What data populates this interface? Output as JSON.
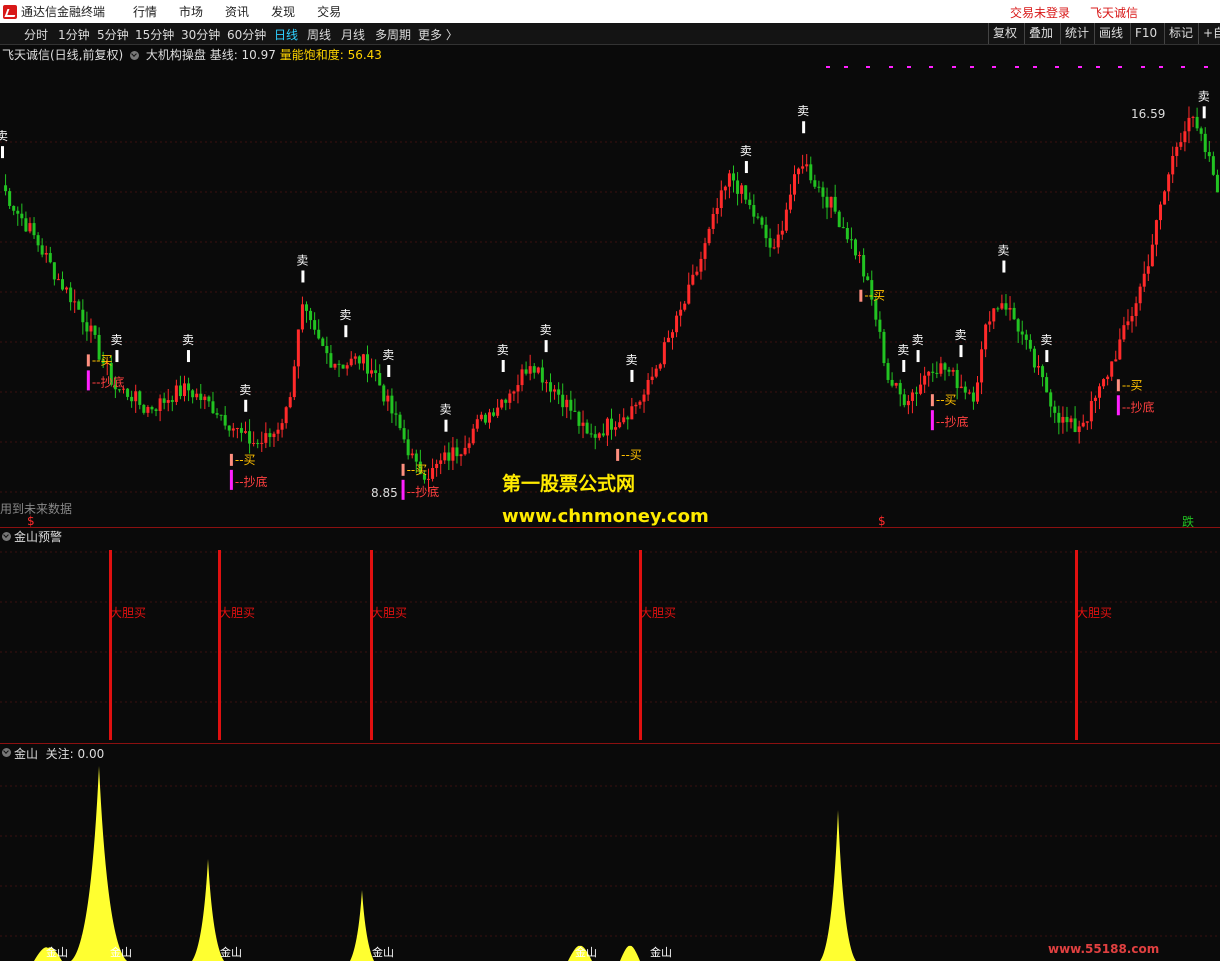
{
  "app": {
    "title": "通达信金融终端",
    "menus": [
      "行情",
      "市场",
      "资讯",
      "发现",
      "交易"
    ],
    "login": "交易未登录",
    "account": "飞天诚信"
  },
  "toolbar": {
    "periods": [
      "分时",
      "1分钟",
      "5分钟",
      "15分钟",
      "30分钟",
      "60分钟",
      "日线",
      "周线",
      "月线",
      "多周期",
      "更多 〉"
    ],
    "active_period": "日线",
    "right_buttons": [
      "复权",
      "叠加",
      "统计",
      "画线",
      "F10",
      "标记",
      "+自"
    ]
  },
  "main_pane": {
    "stock": "飞天诚信(日线,前复权)",
    "indicator": "大机构操盘",
    "baseline_label": "基线: 10.97",
    "saturation_label": "量能饱和度: 56.43",
    "high_label": "16.59",
    "low_label": "8.85",
    "future_note": "用到未来数据",
    "sell_label": "卖",
    "buy_label": "买",
    "bottom_label": "抄底",
    "bottom_marker": "跌",
    "dollar_marker": "$"
  },
  "pane2": {
    "title": "金山预警",
    "signal_label": "大胆买"
  },
  "pane3": {
    "title": "金山",
    "focus_label": "关注: 0.00",
    "bottom_labels": [
      "金山",
      "金山",
      "金山",
      "金山",
      "金山",
      "金山"
    ]
  },
  "watermark": {
    "line1": "第一股票公式网",
    "line2": "www.chnmoney.com",
    "corner": "www.55188.com"
  },
  "colors": {
    "up": "#ff2a2a",
    "down": "#22c322",
    "sell": "#ffffff",
    "buy": "#ffc000",
    "bottom": "#ff20ff",
    "signal": "#e01010",
    "area": "#ffff30",
    "active": "#2fd0ff"
  },
  "chart_data": {
    "type": "candlestick",
    "price_range": [
      8.85,
      16.59
    ],
    "close_series": [
      15.1,
      14.6,
      14.2,
      13.7,
      13.2,
      12.8,
      12.3,
      11.6,
      11.0,
      10.9,
      10.6,
      10.7,
      10.9,
      11.0,
      10.8,
      10.6,
      10.3,
      10.0,
      9.9,
      10.1,
      10.6,
      12.6,
      12.0,
      11.6,
      11.5,
      11.6,
      11.4,
      10.7,
      10.1,
      9.4,
      9.3,
      9.6,
      9.8,
      10.2,
      10.5,
      10.8,
      11.1,
      11.6,
      11.2,
      10.9,
      10.5,
      10.0,
      10.2,
      10.4,
      10.6,
      10.9,
      11.6,
      12.2,
      12.9,
      13.7,
      14.6,
      15.3,
      14.8,
      14.3,
      13.7,
      14.8,
      15.6,
      15.1,
      14.7,
      14.2,
      13.6,
      12.6,
      11.2,
      10.8,
      11.0,
      11.5,
      11.4,
      11.1,
      10.9,
      12.5,
      12.8,
      12.3,
      11.6,
      11.0,
      10.4,
      10.2,
      10.5,
      11.1,
      11.8,
      12.5,
      13.4,
      14.6,
      15.8,
      16.5,
      15.9,
      15.1
    ]
  }
}
